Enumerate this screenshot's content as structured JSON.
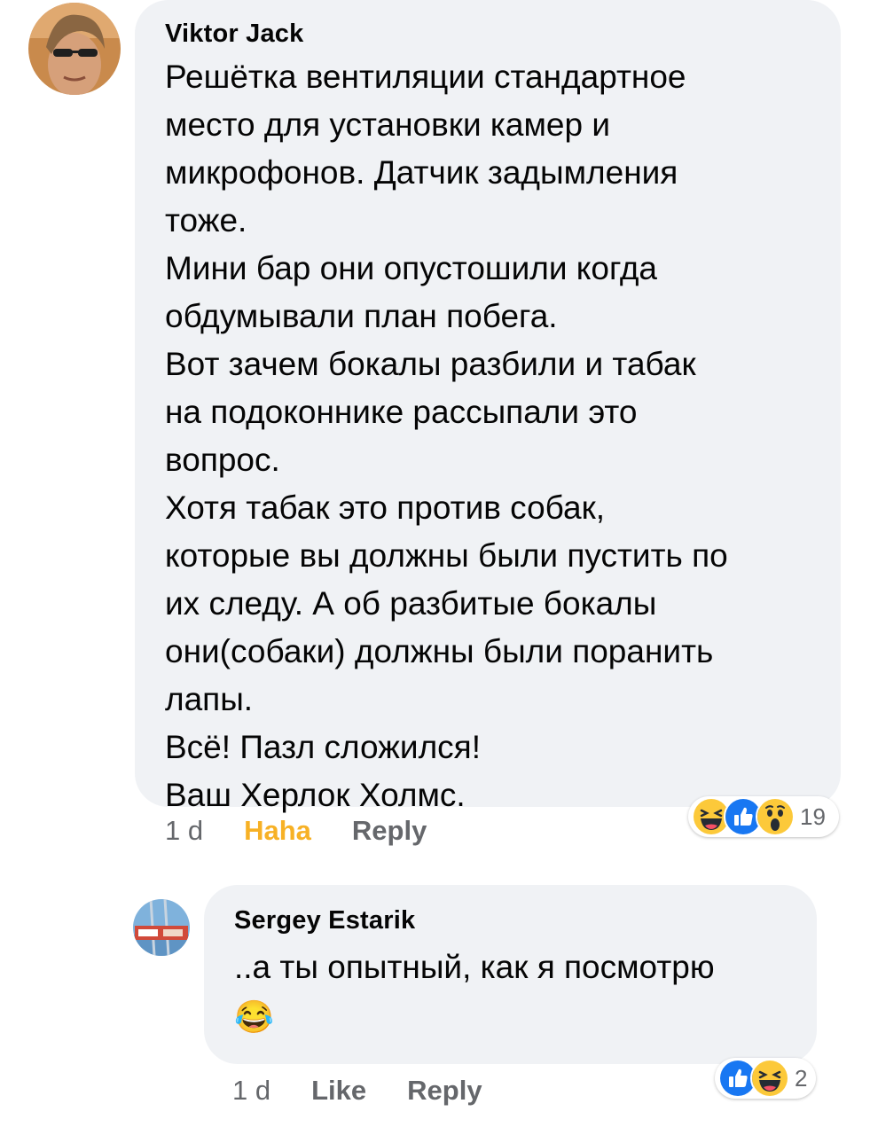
{
  "comments": [
    {
      "author": "Viktor Jack",
      "lines": [
        "Решётка вентиляции стандартное",
        "место для установки камер и",
        "микрофонов. Датчик задымления",
        "тоже.",
        "Мини бар они опустошили когда",
        "обдумывали план побега.",
        "Вот зачем бокалы разбили и табак",
        "на подоконнике рассыпали это",
        "вопрос.",
        "Хотя табак это против собак,",
        "которые вы должны были пустить по",
        "их следу. А об разбитые бокалы",
        "они(собаки) должны были поранить",
        "лапы.",
        "Всё! Пазл сложился!",
        "Ваш Херлок Холмс."
      ],
      "time": "1 d",
      "reaction_action": "Haha",
      "reply_label": "Reply",
      "reaction_icons": [
        "haha-icon",
        "like-icon",
        "wow-icon"
      ],
      "reaction_count": "19"
    },
    {
      "author": "Sergey Estarik",
      "lines": [
        "..а ты опытный, как я посмотрю"
      ],
      "emoji": "😂",
      "time": "1 d",
      "reaction_action": "Like",
      "reply_label": "Reply",
      "reaction_icons": [
        "like-icon",
        "haha-icon"
      ],
      "reaction_count": "2"
    }
  ],
  "colors": {
    "bubble": "#f0f2f5",
    "meta_text": "#65676b",
    "haha_active": "#f7b125",
    "like_blue": "#1877f2",
    "emoji_yellow": "#fcc93a"
  }
}
